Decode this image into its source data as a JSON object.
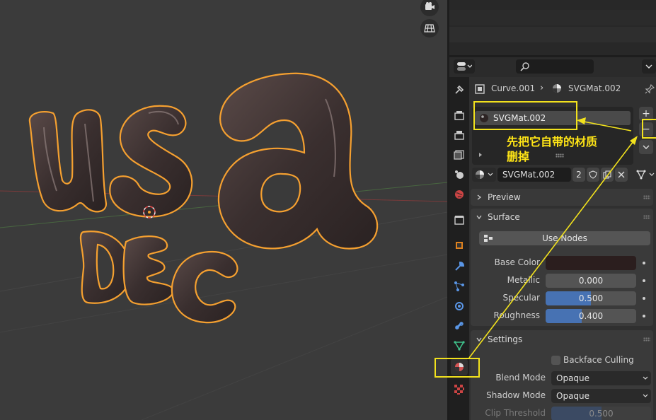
{
  "breadcrumb": {
    "object": "Curve.001",
    "material": "SVGMat.002"
  },
  "material_slots": [
    {
      "name": "SVGMat.002"
    }
  ],
  "material_selector": {
    "name": "SVGMat.002",
    "users": "2"
  },
  "panels": {
    "preview": "Preview",
    "surface": "Surface",
    "settings": "Settings"
  },
  "surface": {
    "use_nodes": "Use Nodes",
    "base_color": {
      "label": "Base Color",
      "color": "#2b1e1e"
    },
    "metallic": {
      "label": "Metallic",
      "value": "0.000",
      "fraction": 0.0
    },
    "specular": {
      "label": "Specular",
      "value": "0.500",
      "fraction": 0.5
    },
    "roughness": {
      "label": "Roughness",
      "value": "0.400",
      "fraction": 0.4
    }
  },
  "settings": {
    "backface_culling": "Backface Culling",
    "blend_mode": {
      "label": "Blend Mode",
      "value": "Opaque"
    },
    "shadow_mode": {
      "label": "Shadow Mode",
      "value": "Opaque"
    },
    "clip_threshold": {
      "label": "Clip Threshold",
      "value": "0.500"
    }
  },
  "annotation": {
    "line1": "先把它自带的材质",
    "line2": "删掉"
  },
  "scene_text": {
    "top_word": "usa",
    "bottom_word": "DEC"
  },
  "colors": {
    "highlight": "#f2e21d",
    "outline": "#f5a030",
    "active_blue": "#4772b3"
  },
  "icons": [
    "camera-icon",
    "grid-icon",
    "editor-type-icon",
    "search-icon",
    "chevron-down-icon",
    "pin-icon",
    "tool-icon",
    "render-icon",
    "output-icon",
    "view-layer-icon",
    "scene-icon",
    "world-icon",
    "collection-icon",
    "object-icon",
    "modifier-icon",
    "particles-icon",
    "physics-icon",
    "constraints-icon",
    "data-icon",
    "material-icon",
    "texture-icon"
  ]
}
